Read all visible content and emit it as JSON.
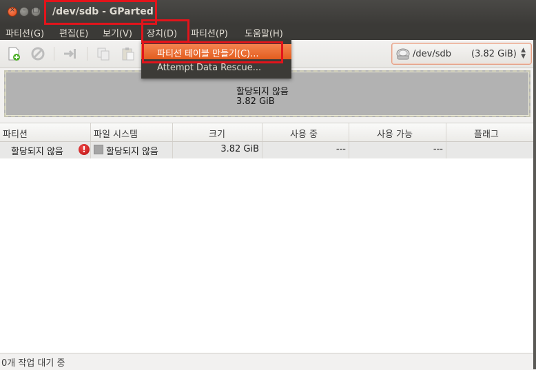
{
  "window": {
    "title": "/dev/sdb - GParted"
  },
  "menubar": {
    "items": [
      "파티션(G)",
      "편집(E)",
      "보기(V)",
      "장치(D)",
      "파티션(P)",
      "도움말(H)"
    ]
  },
  "device_menu": {
    "items": [
      "파티션 테이블 만들기(C)...",
      "Attempt Data Rescue..."
    ]
  },
  "device_selector": {
    "name": "/dev/sdb",
    "size": "(3.82 GiB)"
  },
  "disk_map": {
    "label": "할당되지 않음",
    "size": "3.82 GiB"
  },
  "table": {
    "columns": [
      "파티션",
      "파일 시스템",
      "크기",
      "사용 중",
      "사용 가능",
      "플래그"
    ],
    "rows": [
      {
        "partition": "할당되지 않음",
        "filesystem": "할당되지 않음",
        "size": "3.82 GiB",
        "used": "---",
        "unused": "---",
        "flags": ""
      }
    ]
  },
  "statusbar": {
    "text": "0개 작업 대기 중"
  },
  "icons": {
    "new": "new-partition-icon",
    "delete": "delete-icon",
    "resize": "resize-move-icon",
    "copy": "copy-icon",
    "paste": "paste-icon",
    "disk": "disk-drive-icon"
  },
  "colors": {
    "highlight": "#e3141b",
    "menu_selected": "#e35d1f",
    "titlebar": "#3b3a37"
  }
}
